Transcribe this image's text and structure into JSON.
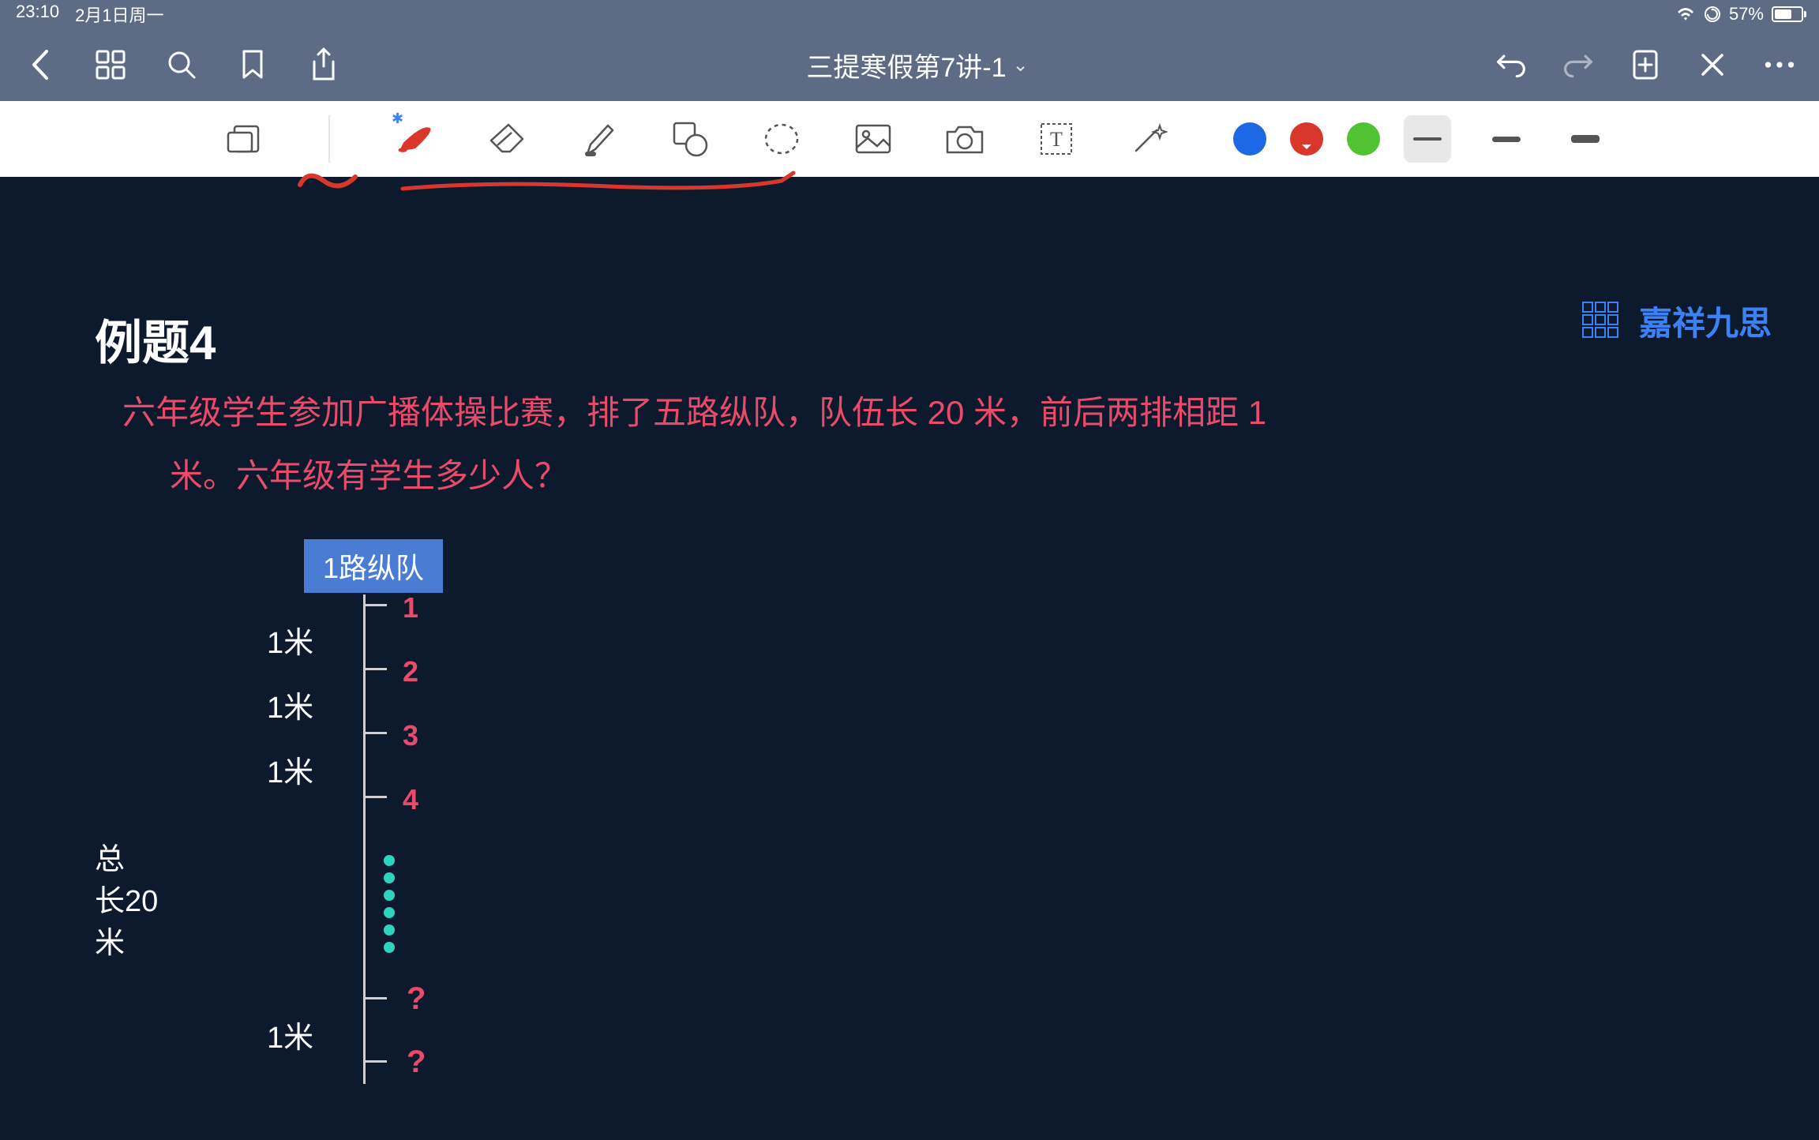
{
  "status": {
    "time": "23:10",
    "date": "2月1日周一",
    "battery_pct": "57%",
    "battery_icon": "⚡"
  },
  "nav": {
    "title": "三提寒假第7讲-1",
    "dropdown_glyph": "⌄"
  },
  "toolbar": {
    "bluetooth_glyph": "✱"
  },
  "content": {
    "example_label": "例题4",
    "brand_text": "嘉祥九思",
    "problem_line1": "六年级学生参加广播体操比赛，排了五路纵队，队伍长 20 米，前后两排相距 1",
    "problem_line2": "米。六年级有学生多少人？",
    "column_header": "1路纵队",
    "total_length_l1": "总",
    "total_length_l2": "长20",
    "total_length_l3": "米",
    "gap_label_1": "1米",
    "gap_label_2": "1米",
    "gap_label_3": "1米",
    "gap_label_last": "1米",
    "num_1": "1",
    "num_2": "2",
    "num_3": "3",
    "num_4": "4",
    "q1": "?",
    "q2": "?"
  }
}
